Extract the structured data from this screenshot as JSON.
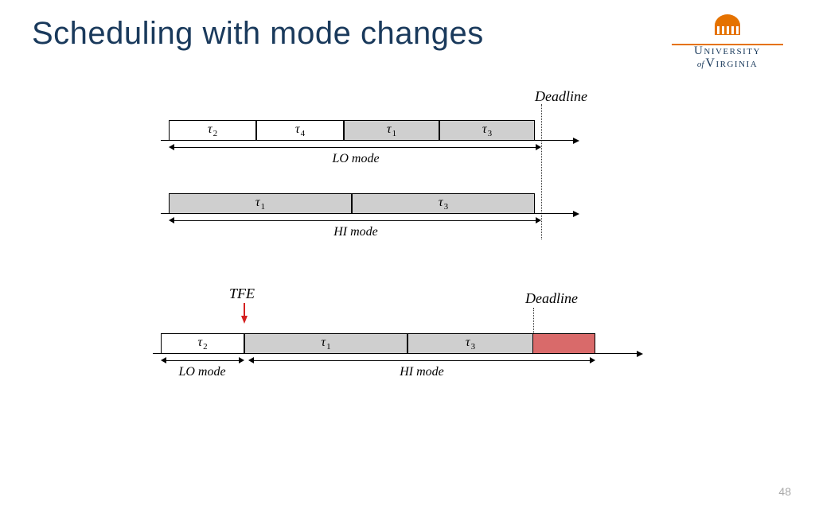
{
  "title": "Scheduling with mode changes",
  "logo": {
    "uni": "University",
    "of": "of",
    "va": "Virginia"
  },
  "page_number": "48",
  "labels": {
    "deadline": "Deadline",
    "lo_mode": "LO mode",
    "hi_mode": "HI mode",
    "tfe": "TFE"
  },
  "tasks": {
    "t1": "τ₁",
    "t2": "τ₂",
    "t3": "τ₃",
    "t4": "τ₄"
  },
  "chart_data": {
    "type": "table",
    "description": "Three timeline diagrams showing task scheduling under LO and HI criticality modes with a shared deadline.",
    "deadline_position_rel": 0.76,
    "timelines": [
      {
        "name": "LO mode schedule",
        "brace_label": "LO mode",
        "tasks": [
          {
            "id": "τ2",
            "width_rel": 0.19,
            "fill": "white"
          },
          {
            "id": "τ4",
            "width_rel": 0.19,
            "fill": "white"
          },
          {
            "id": "τ1",
            "width_rel": 0.19,
            "fill": "gray"
          },
          {
            "id": "τ3",
            "width_rel": 0.19,
            "fill": "gray"
          }
        ]
      },
      {
        "name": "HI mode schedule",
        "brace_label": "HI mode",
        "tasks": [
          {
            "id": "τ1",
            "width_rel": 0.38,
            "fill": "gray"
          },
          {
            "id": "τ3",
            "width_rel": 0.38,
            "fill": "gray"
          }
        ]
      },
      {
        "name": "Mode change at TFE",
        "tfe_position_rel": 0.18,
        "segments": [
          {
            "label": "LO mode",
            "start_rel": 0.0,
            "end_rel": 0.18
          },
          {
            "label": "HI mode",
            "start_rel": 0.18,
            "end_rel": 0.9
          }
        ],
        "tasks": [
          {
            "id": "τ2",
            "width_rel": 0.18,
            "fill": "white"
          },
          {
            "id": "τ1",
            "width_rel": 0.34,
            "fill": "gray"
          },
          {
            "id": "τ3",
            "width_rel": 0.26,
            "fill": "gray"
          },
          {
            "id": "τ3_overflow",
            "width_rel": 0.12,
            "fill": "red",
            "note": "exceeds deadline"
          }
        ]
      }
    ]
  }
}
